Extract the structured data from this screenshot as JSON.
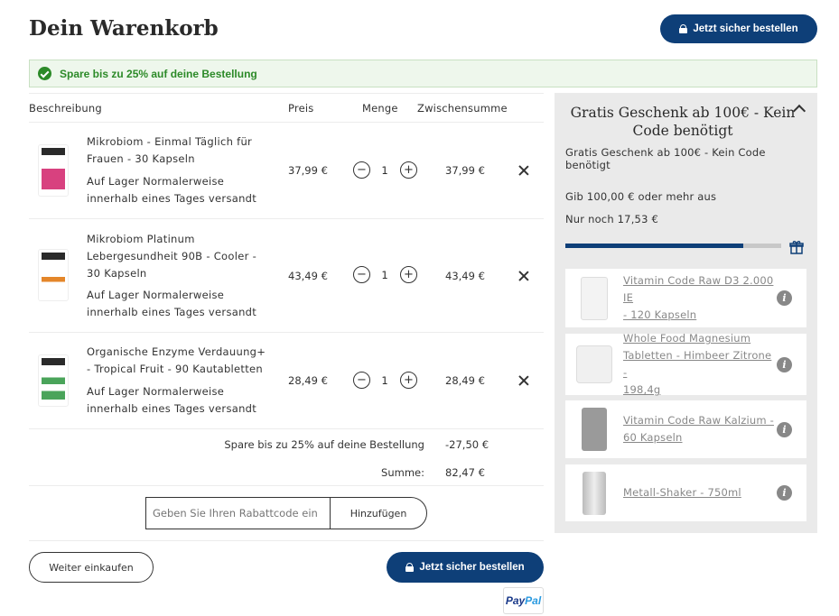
{
  "header": {
    "title": "Dein Warenkorb",
    "checkout_label": "Jetzt sicher bestellen"
  },
  "banner": {
    "text": "Spare bis zu 25% auf deine Bestellung",
    "color": "#2c8a28"
  },
  "table": {
    "headers": {
      "description": "Beschreibung",
      "price": "Preis",
      "quantity": "Menge",
      "subtotal": "Zwischensumme"
    },
    "items": [
      {
        "name_lines": [
          "Mikrobiom - Einmal Täglich für",
          "Frauen - 30 Kapseln"
        ],
        "stock_lines": [
          "Auf Lager   Normalerweise",
          "innerhalb eines Tages versandt"
        ],
        "price": "37,99 €",
        "quantity": "1",
        "subtotal": "37,99 €",
        "thumb_color": "#d8417f"
      },
      {
        "name_lines": [
          "Mikrobiom Platinum",
          "Lebergesundheit 90B - Cooler -",
          "30 Kapseln"
        ],
        "stock_lines": [
          "Auf Lager   Normalerweise",
          "innerhalb eines Tages versandt"
        ],
        "price": "43,49 €",
        "quantity": "1",
        "subtotal": "43,49 €",
        "thumb_color": "#e4862a"
      },
      {
        "name_lines": [
          "Organische Enzyme Verdauung+",
          "- Tropical Fruit - 90 Kautabletten"
        ],
        "stock_lines": [
          "Auf Lager   Normalerweise",
          "innerhalb eines Tages versandt"
        ],
        "price": "28,49 €",
        "quantity": "1",
        "subtotal": "28,49 €",
        "thumb_color": "#4aa45a"
      }
    ]
  },
  "totals": {
    "discount_label": "Spare bis zu 25% auf deine Bestellung",
    "discount_value": "-27,50 €",
    "sum_label": "Summe:",
    "sum_value": "82,47 €"
  },
  "coupon": {
    "placeholder": "Geben Sie Ihren Rabattcode ein",
    "add_label": "Hinzufügen"
  },
  "footer": {
    "continue_label": "Weiter einkaufen",
    "checkout_label": "Jetzt sicher bestellen",
    "paypal_pay": "Pay",
    "paypal_pal": "Pal"
  },
  "gift": {
    "title": "Gratis Geschenk ab 100€ - Kein Code benötigt",
    "subtitle": "Gratis Geschenk ab 100€ - Kein Code benötigt",
    "threshold_text": "Gib 100,00 € oder mehr aus",
    "remaining_text": "Nur noch 17,53 €",
    "progress_fraction": 0.825,
    "progress_color": "#0e3f78",
    "products": [
      {
        "lines": [
          "Vitamin Code Raw D3 2.000 IE",
          "- 120 Kapseln"
        ]
      },
      {
        "lines": [
          "Whole Food Magnesium",
          "Tabletten - Himbeer Zitrone -",
          "198,4g"
        ]
      },
      {
        "lines": [
          "Vitamin Code Raw Kalzium -",
          "60 Kapseln"
        ]
      },
      {
        "lines": [
          "Metall-Shaker - 750ml"
        ]
      }
    ]
  },
  "colors": {
    "primary": "#0e3f78",
    "panel_bg": "#eaeaea",
    "banner_bg": "#eef7ec"
  }
}
